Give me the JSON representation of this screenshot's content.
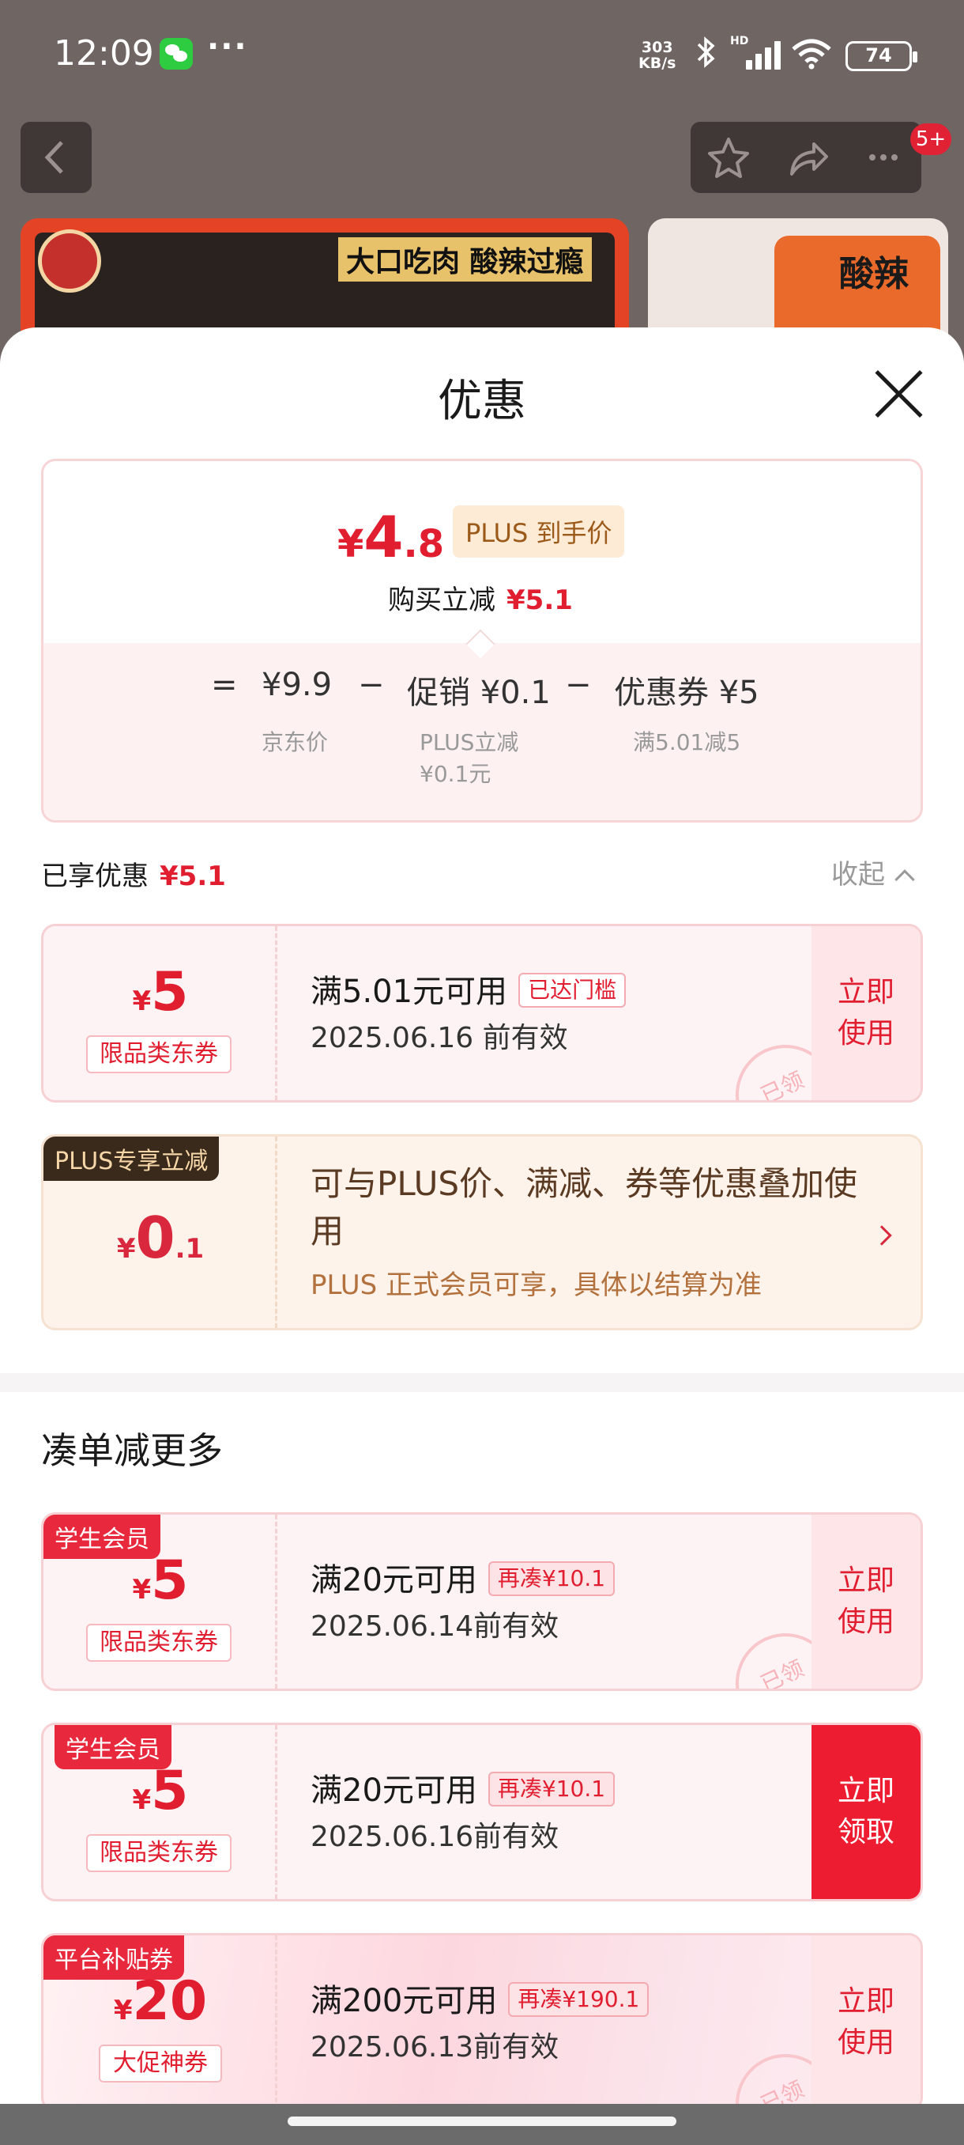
{
  "status_bar": {
    "time": "12:09",
    "more": "···",
    "net_speed_value": "303",
    "net_speed_unit": "KB/s",
    "hd": "HD",
    "battery": "74"
  },
  "nav": {
    "badge": "5+"
  },
  "banner": {
    "slogan": "大口吃肉 酸辣过瘾",
    "side_label": "酸辣"
  },
  "sheet": {
    "title": "优惠",
    "summary": {
      "yen": "¥",
      "price_int": "4",
      "price_dec": ".8",
      "plus_label": "PLUS 到手价",
      "direct_label": "购买立减",
      "direct_value": "¥5.1",
      "eq": "=",
      "minus1": "−",
      "minus2": "−",
      "item1_value": "¥9.9",
      "item1_label": "京东价",
      "item2_value": "促销 ¥0.1",
      "item2_label_line1": "PLUS立减",
      "item2_label_line2": "¥0.1元",
      "item3_value": "优惠券 ¥5",
      "item3_label": "满5.01减5"
    },
    "enjoyed": {
      "label": "已享优惠",
      "value": "¥5.1",
      "collapse": "收起"
    },
    "applied_coupons": [
      {
        "yen": "¥",
        "amount": "5",
        "type": "限品类东券",
        "condition": "满5.01元可用",
        "badge": "已达门槛",
        "date": "2025.06.16 前有效",
        "button_line1": "立即",
        "button_line2": "使用",
        "stamp": "已领"
      }
    ],
    "plus_card": {
      "tag": "PLUS专享立减",
      "yen": "¥",
      "int": "0",
      "dec": ".1",
      "title": "可与PLUS价、满减、券等优惠叠加使用",
      "note": "PLUS 正式会员可享，具体以结算为准"
    },
    "more_section": {
      "title": "凑单减更多"
    },
    "more_coupons": [
      {
        "tag": "学生会员",
        "yen": "¥",
        "amount": "5",
        "type": "限品类东券",
        "condition": "满20元可用",
        "badge": "再凑¥10.1",
        "date": "2025.06.14前有效",
        "button_line1": "立即",
        "button_line2": "使用",
        "stamp": "已领"
      },
      {
        "tag": "学生会员",
        "yen": "¥",
        "amount": "5",
        "type": "限品类东券",
        "condition": "满20元可用",
        "badge": "再凑¥10.1",
        "date": "2025.06.16前有效",
        "button_line1": "立即",
        "button_line2": "领取"
      },
      {
        "tag": "平台补贴券",
        "yen": "¥",
        "amount": "20",
        "type": "大促神券",
        "condition": "满200元可用",
        "badge": "再凑¥190.1",
        "date": "2025.06.13前有效",
        "button_line1": "立即",
        "button_line2": "使用",
        "stamp": "已领"
      }
    ]
  },
  "colors": {
    "accent_red": "#e11d30",
    "plus_gold": "#9b5a19",
    "sheet_bg": "#ffffff"
  }
}
